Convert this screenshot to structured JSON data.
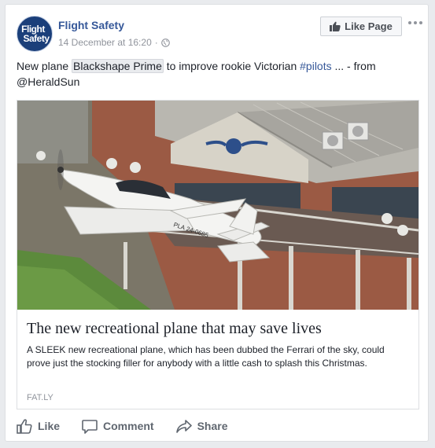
{
  "post": {
    "page_name": "Flight Safety",
    "avatar_line1": "Flight",
    "avatar_line2": "Safety",
    "timestamp": "14 December at 16:20",
    "separator": "·",
    "like_page_label": "Like Page",
    "text_before": "New plane ",
    "text_highlight": "Blackshape Prime",
    "text_middle": " to improve rookie Victorian ",
    "text_hashtag": "#pilots",
    "text_after": " ... - from @HeraldSun"
  },
  "attachment": {
    "photo_text": "PLA 24-0685",
    "title": "The new recreational plane that may save lives",
    "description": "A SLEEK new recreational plane, which has been dubbed the Ferrari of the sky, could prove just the stocking filler for anybody with a little cash to splash this Christmas.",
    "source": "FAT.LY"
  },
  "actions": {
    "like": "Like",
    "comment": "Comment",
    "share": "Share"
  },
  "colors": {
    "link_blue": "#365899",
    "meta_gray": "#90949c",
    "action_gray": "#606770"
  }
}
